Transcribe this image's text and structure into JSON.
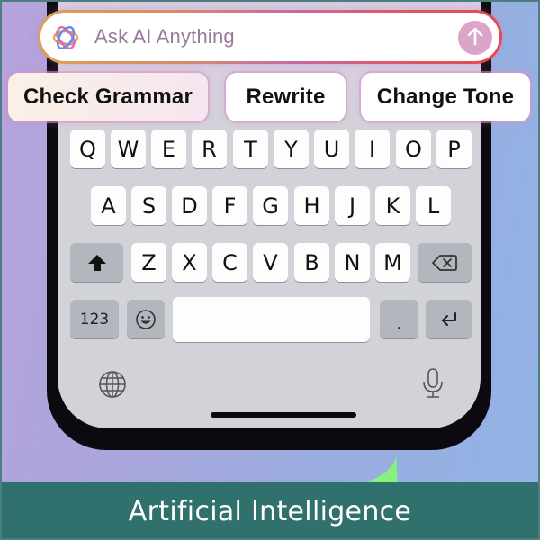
{
  "ai_bar": {
    "placeholder": "Ask AI Anything",
    "logo_icon": "ai-flower-logo-icon",
    "send_icon": "arrow-up-icon",
    "send_color": "#dca4c8"
  },
  "suggestions": [
    {
      "label": "Check Grammar"
    },
    {
      "label": "Rewrite"
    },
    {
      "label": "Change Tone"
    }
  ],
  "keyboard": {
    "row1": [
      "Q",
      "W",
      "E",
      "R",
      "T",
      "Y",
      "U",
      "I",
      "O",
      "P"
    ],
    "row2": [
      "A",
      "S",
      "D",
      "F",
      "G",
      "H",
      "J",
      "K",
      "L"
    ],
    "row3": [
      "Z",
      "X",
      "C",
      "V",
      "B",
      "N",
      "M"
    ],
    "shift_icon": "shift-icon",
    "delete_icon": "backspace-icon",
    "numbers_label": "123",
    "emoji_icon": "emoji-icon",
    "space_label": "",
    "period_label": ".",
    "return_icon": "return-icon",
    "globe_icon": "globe-icon",
    "mic_icon": "microphone-icon"
  },
  "caption": {
    "text": "Artificial Intelligence",
    "background": "#30706d"
  }
}
